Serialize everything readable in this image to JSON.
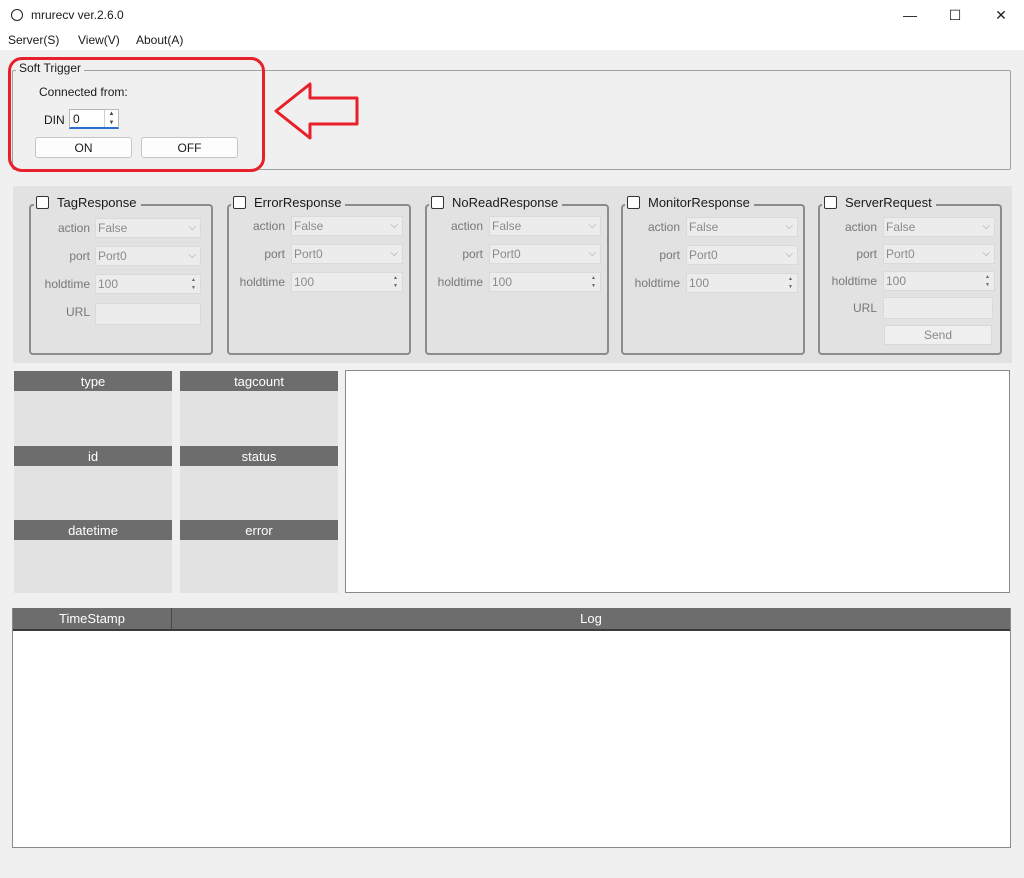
{
  "window": {
    "title": "mrurecv ver.2.6.0",
    "minimize_glyph": "—",
    "maximize_glyph": "☐",
    "close_glyph": "✕"
  },
  "menu": [
    "Server(S)",
    "View(V)",
    "About(A)"
  ],
  "soft_trigger": {
    "title": "Soft Trigger",
    "connected_from": "Connected from:",
    "din_label": "DIN",
    "din_value": "0",
    "on_label": "ON",
    "off_label": "OFF"
  },
  "annotation": {
    "highlight_color": "#e8202a",
    "arrow": "left-arrow"
  },
  "responses": [
    {
      "title": "TagResponse",
      "checked": false,
      "action_label": "action",
      "action": "False",
      "port_label": "port",
      "port": "Port0",
      "holdtime_label": "holdtime",
      "holdtime": "100",
      "url_label": "URL",
      "url": ""
    },
    {
      "title": "ErrorResponse",
      "checked": false,
      "action_label": "action",
      "action": "False",
      "port_label": "port",
      "port": "Port0",
      "holdtime_label": "holdtime",
      "holdtime": "100"
    },
    {
      "title": "NoReadResponse",
      "checked": false,
      "action_label": "action",
      "action": "False",
      "port_label": "port",
      "port": "Port0",
      "holdtime_label": "holdtime",
      "holdtime": "100"
    },
    {
      "title": "MonitorResponse",
      "checked": false,
      "action_label": "action",
      "action": "False",
      "port_label": "port",
      "port": "Port0",
      "holdtime_label": "holdtime",
      "holdtime": "100"
    },
    {
      "title": "ServerRequest",
      "checked": false,
      "action_label": "action",
      "action": "False",
      "port_label": "port",
      "port": "Port0",
      "holdtime_label": "holdtime",
      "holdtime": "100",
      "url_label": "URL",
      "url": "",
      "send_label": "Send"
    }
  ],
  "info": {
    "type": "type",
    "tagcount": "tagcount",
    "id": "id",
    "status": "status",
    "datetime": "datetime",
    "error": "error"
  },
  "log": {
    "timestamp_header": "TimeStamp",
    "log_header": "Log"
  },
  "colors": {
    "header_bg": "#6d6d6d",
    "panel_bg": "#e2e2e2",
    "window_bg": "#f0f0f0"
  }
}
